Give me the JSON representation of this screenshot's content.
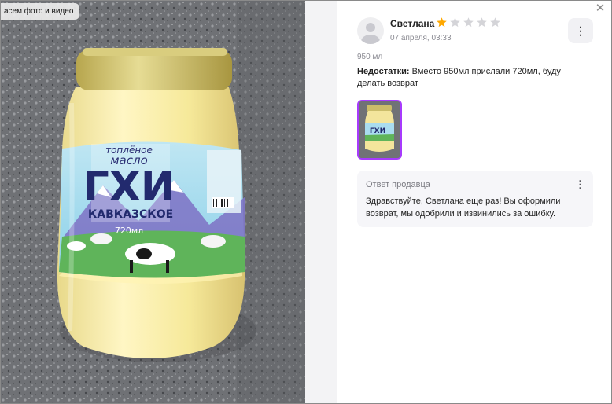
{
  "media_viewer": {
    "all_media_label": "асем фото и видео",
    "label_lines": {
      "line1": "топлёное",
      "line2": "масло",
      "brand": "ГХИ",
      "line3": "КАВКАЗСКОЕ",
      "volume": "720мл"
    }
  },
  "review": {
    "author": "Светлана",
    "rating": 1,
    "max_rating": 5,
    "date": "07 апреля, 03:33",
    "variant": "950 мл",
    "cons_label": "Недостатки:",
    "cons_text": " Вместо 950мл прислали 720мл, буду делать возврат"
  },
  "seller_reply": {
    "title": "Ответ продавца",
    "text": "Здравствуйте, Светлана еще раз! Вы оформили возврат, мы одобрили и извинились за ошибку."
  },
  "colors": {
    "star_active": "#ffa800",
    "star_inactive": "#d4d4d8",
    "thumb_border": "#a73afd"
  },
  "icons": {
    "close": "close-icon",
    "more": "kebab-icon",
    "avatar": "user-placeholder-icon"
  }
}
